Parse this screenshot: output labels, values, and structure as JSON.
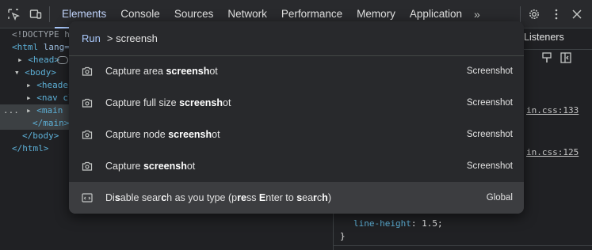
{
  "toolbar": {
    "tabs": [
      "Elements",
      "Console",
      "Sources",
      "Network",
      "Performance",
      "Memory",
      "Application"
    ],
    "more_tabs": "»"
  },
  "dom_tree": {
    "doctype": "<!DOCTYPE h",
    "html_tag": "<html",
    "html_attr": " lang=",
    "head": "<head>",
    "body": "<body>",
    "header": "<header",
    "nav": "<nav cl",
    "main": "<main c",
    "main_close": "</main>",
    "body_close": "</body>",
    "html_close": "</html>",
    "ellipsis": "..."
  },
  "styles_panel": {
    "listeners_tab": "Listeners",
    "link1": "in.css:133",
    "link2": "in.css:125",
    "prop": "line-height",
    "value": "1.5;",
    "close_brace": "}"
  },
  "palette": {
    "run_label": "Run",
    "query": "> screensh",
    "items": [
      {
        "pre": "Capture area ",
        "bold": "screensh",
        "post": "ot",
        "category": "Screenshot"
      },
      {
        "pre": "Capture full size ",
        "bold": "screensh",
        "post": "ot",
        "category": "Screenshot"
      },
      {
        "pre": "Capture node ",
        "bold": "screensh",
        "post": "ot",
        "category": "Screenshot"
      },
      {
        "pre": "Capture ",
        "bold": "screensh",
        "post": "ot",
        "category": "Screenshot"
      }
    ],
    "last_item": {
      "p1": "Di",
      "b1": "s",
      "p2": "able sear",
      "b2": "c",
      "p3": "h as you type (p",
      "b3": "r",
      "p4": "",
      "b4": "e",
      "p5": "ss ",
      "b5": "E",
      "p6": "nter to ",
      "b6": "s",
      "p7": "ea",
      "b7": "r",
      "p8": "c",
      "b8": "h",
      "p9": ")",
      "category": "Global"
    }
  }
}
